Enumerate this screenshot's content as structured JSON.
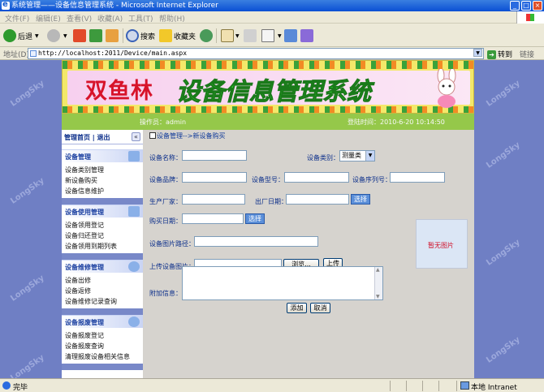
{
  "window": {
    "title": "系统管理——设备信息管理系统 - Microsoft Internet Explorer",
    "min": "_",
    "max": "□",
    "close": "×"
  },
  "menu": [
    "文件(F)",
    "编辑(E)",
    "查看(V)",
    "收藏(A)",
    "工具(T)",
    "帮助(H)"
  ],
  "toolbar": {
    "back": "后退",
    "search": "搜索",
    "favorites": "收藏夹"
  },
  "address": {
    "label": "地址(D)",
    "url": "http://localhost:2011/Device/main.aspx",
    "go": "转到",
    "links": "链接"
  },
  "banner": {
    "title_a": "双鱼林",
    "title_b": "设备信息管理系统"
  },
  "userbar": {
    "operator": "操作员：admin",
    "login_time": "登陆时间：2010-6-20 10:14:50"
  },
  "sidebar": {
    "head": "管理首页 | 退出",
    "collapse": "«",
    "sections": [
      {
        "title": "设备管理",
        "items": [
          "设备类别管理",
          "新设备购买",
          "设备信息维护"
        ]
      },
      {
        "title": "设备使用管理",
        "items": [
          "设备领用登记",
          "设备归还登记",
          "设备领用到期列表"
        ]
      },
      {
        "title": "设备维修管理",
        "items": [
          "设备出修",
          "设备返修",
          "设备维修记录查询"
        ]
      },
      {
        "title": "设备报废管理",
        "items": [
          "设备报废登记",
          "设备报废查询",
          "清理报废设备相关信息"
        ]
      }
    ]
  },
  "main": {
    "breadcrumb": "设备管理-->新设备购买",
    "labels": {
      "name": "设备名称：",
      "category": "设备类别：",
      "brand": "设备品牌：",
      "model": "设备型号：",
      "serial": "设备序列号：",
      "maker": "生产厂家：",
      "factory_date": "出厂日期：",
      "buy_date": "购买日期：",
      "image_path": "设备图片路径：",
      "upload": "上传设备图片：",
      "extra": "附加信息："
    },
    "category_value": "测量类",
    "pick_label": "选择",
    "browse_label": "浏览...",
    "upload_btn": "上传",
    "no_image": "暂无图片",
    "add_btn": "添加",
    "cancel_btn": "取消"
  },
  "status": {
    "left": "完毕",
    "zone": "本地 Intranet"
  },
  "watermark": "LongSky"
}
